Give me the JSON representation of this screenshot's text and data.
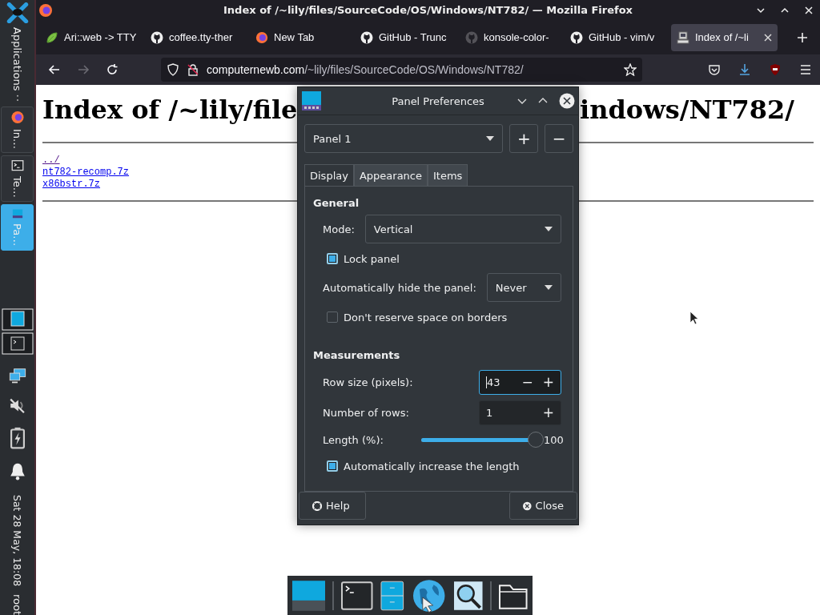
{
  "desktop_panel": {
    "launcher": "Applications",
    "tasks": [
      {
        "kind": "browser",
        "label": "In…",
        "selected": false
      },
      {
        "kind": "terminal",
        "label": "Te…",
        "selected": false
      },
      {
        "kind": "panel",
        "label": "Pa…",
        "selected": true
      }
    ],
    "clock": "Sat 28 May, 18:08",
    "user": "root"
  },
  "window": {
    "title": "Index of /~lily/files/SourceCode/OS/Windows/NT782/ — Mozilla Firefox"
  },
  "tabs": [
    {
      "kind": "leaf",
      "label": "Ari::web -> TTY",
      "selected": false
    },
    {
      "kind": "github",
      "label": "coffee.tty-ther",
      "selected": false
    },
    {
      "kind": "firefox",
      "label": "New Tab",
      "selected": false
    },
    {
      "kind": "github",
      "label": "GitHub - Trunc",
      "selected": false
    },
    {
      "kind": "github-dim",
      "label": "konsole-color-",
      "selected": false
    },
    {
      "kind": "github",
      "label": "GitHub - vim/v",
      "selected": false
    },
    {
      "kind": "computer",
      "label": "Index of /~li",
      "selected": true
    }
  ],
  "nav_buttons": [
    {
      "kind": "back",
      "disabled": false
    },
    {
      "kind": "forward",
      "disabled": true
    },
    {
      "kind": "reload",
      "disabled": false
    }
  ],
  "address_bar": {
    "host": "computernewb.com",
    "path": "/~lily/files/SourceCode/OS/Windows/NT782/"
  },
  "page": {
    "heading_visible": [
      "Index of /~lily/file",
      "indows/NT782/"
    ],
    "links": [
      "../",
      "nt782-recomp.7z",
      "x86bstr.7z"
    ]
  },
  "dialog": {
    "title": "Panel Preferences",
    "panel_select": "Panel 1",
    "panel_buttons": [
      "+",
      "−"
    ],
    "tabs": [
      {
        "label": "Display",
        "selected": true
      },
      {
        "label": "Appearance",
        "selected": false
      },
      {
        "label": "Items",
        "selected": false
      }
    ],
    "sections": [
      {
        "heading": "General",
        "rows": [
          {
            "kind": "select",
            "label": "Mode:",
            "value": "Vertical"
          },
          {
            "kind": "checkbox",
            "label": "Lock panel",
            "checked": true
          },
          {
            "kind": "select",
            "label": "Automatically hide the panel:",
            "value": "Never"
          },
          {
            "kind": "checkbox",
            "label": "Don't reserve space on borders",
            "checked": false
          }
        ]
      },
      {
        "heading": "Measurements",
        "rows": [
          {
            "kind": "spin",
            "label": "Row size (pixels):",
            "value": "43",
            "buttons": [
              "−",
              "+"
            ],
            "focused": true
          },
          {
            "kind": "spin",
            "label": "Number of rows:",
            "value": "1",
            "buttons": [
              "+"
            ],
            "focused": false
          },
          {
            "kind": "slider",
            "label": "Length (%):",
            "level": 1,
            "reading": "100"
          },
          {
            "kind": "checkbox",
            "label": "Automatically increase the length",
            "checked": true
          }
        ]
      }
    ],
    "buttons": [
      {
        "kind": "help",
        "label": "Help"
      },
      {
        "kind": "close",
        "label": "Close"
      }
    ]
  }
}
